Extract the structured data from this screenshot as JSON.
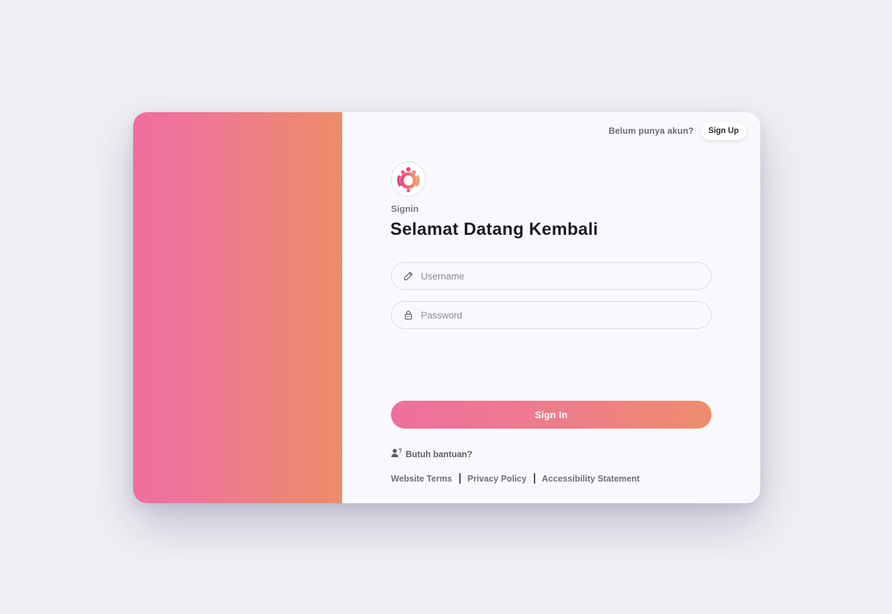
{
  "header": {
    "prompt_text": "Belum punya akun?",
    "signup_label": "Sign Up"
  },
  "form": {
    "eyebrow": "Signin",
    "title": "Selamat Datang Kembali",
    "username": {
      "placeholder": "Username",
      "value": "",
      "icon": "pencil-icon"
    },
    "password": {
      "placeholder": "Password",
      "value": "",
      "icon": "lock-icon"
    },
    "submit_label": "Sign In"
  },
  "help": {
    "label": "Butuh bantuan?",
    "icon": "user-question-icon"
  },
  "footer": {
    "links": [
      "Website Terms",
      "Privacy Policy",
      "Accessibility Statement"
    ]
  },
  "colors": {
    "background": "#f0f0f4",
    "card": "#f9f9fd",
    "gradient_start": "#ee6f9e",
    "gradient_end": "#ed8d68",
    "title": "#1b1b22"
  }
}
